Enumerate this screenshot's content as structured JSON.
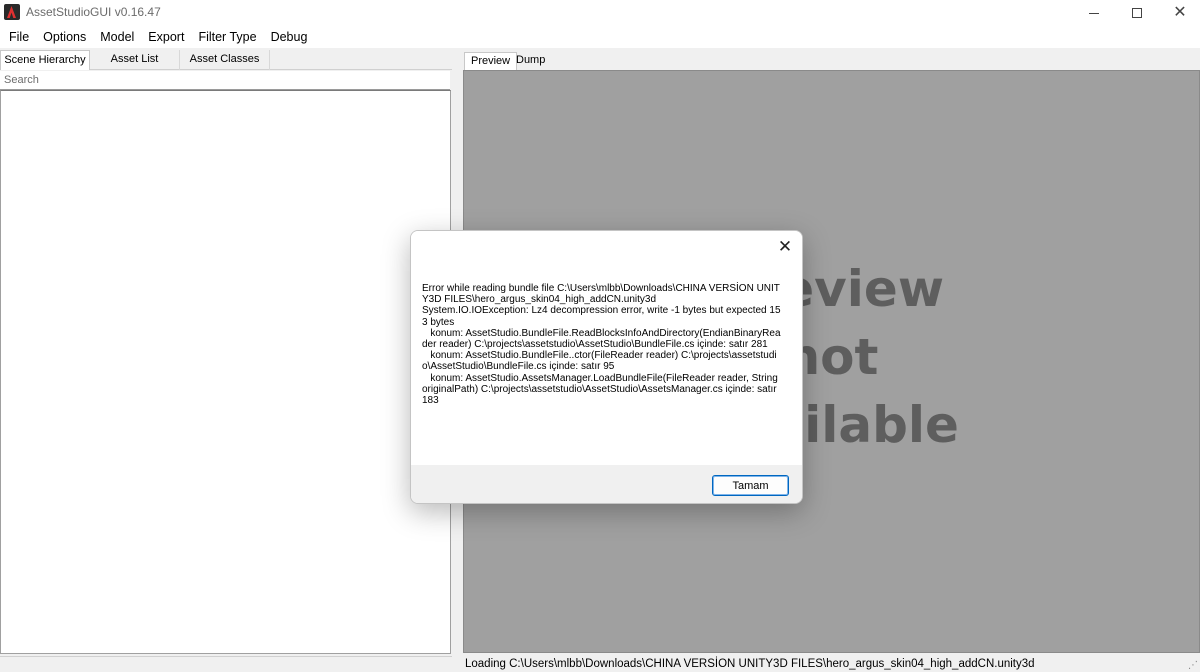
{
  "window": {
    "title": "AssetStudioGUI v0.16.47"
  },
  "menu": {
    "items": [
      "File",
      "Options",
      "Model",
      "Export",
      "Filter Type",
      "Debug"
    ]
  },
  "left_panel": {
    "tabs": [
      "Scene Hierarchy",
      "Asset List",
      "Asset Classes"
    ],
    "active_tab": "Scene Hierarchy",
    "search_placeholder": "Search"
  },
  "right_panel": {
    "tabs": [
      "Preview",
      "Dump"
    ],
    "active_tab": "Preview",
    "preview_placeholder": "Preview not available"
  },
  "status": {
    "text": "Loading C:\\Users\\mlbb\\Downloads\\CHINA VERSİON UNITY3D FILES\\hero_argus_skin04_high_addCN.unity3d"
  },
  "dialog": {
    "message": "Error while reading bundle file C:\\Users\\mlbb\\Downloads\\CHINA VERSİON UNITY3D FILES\\hero_argus_skin04_high_addCN.unity3d\nSystem.IO.IOException: Lz4 decompression error, write -1 bytes but expected 153 bytes\n   konum: AssetStudio.BundleFile.ReadBlocksInfoAndDirectory(EndianBinaryReader reader) C:\\projects\\assetstudio\\AssetStudio\\BundleFile.cs içinde: satır 281\n   konum: AssetStudio.BundleFile..ctor(FileReader reader) C:\\projects\\assetstudio\\AssetStudio\\BundleFile.cs içinde: satır 95\n   konum: AssetStudio.AssetsManager.LoadBundleFile(FileReader reader, String originalPath) C:\\projects\\assetstudio\\AssetStudio\\AssetsManager.cs içinde: satır 183",
    "ok_label": "Tamam"
  }
}
